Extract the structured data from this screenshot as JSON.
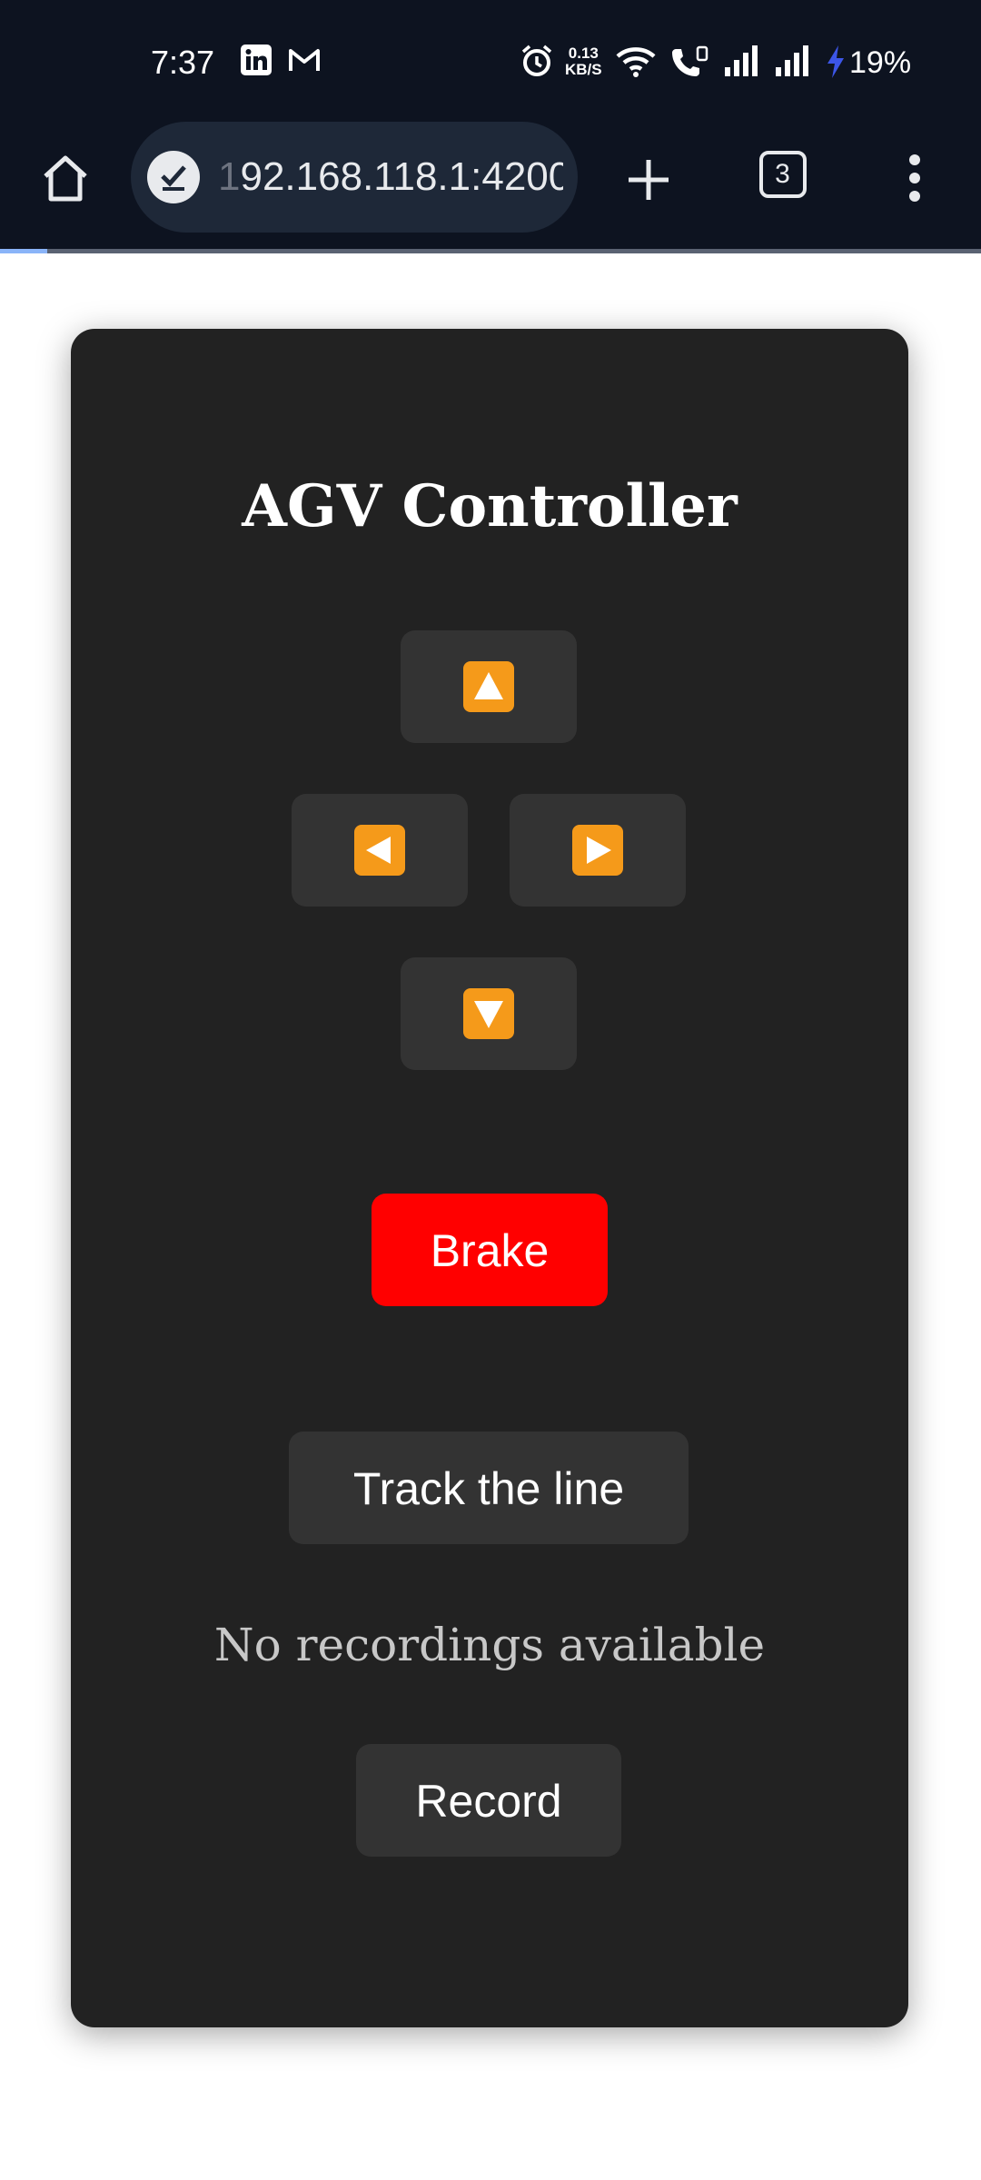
{
  "status_bar": {
    "time": "7:37",
    "network_speed_value": "0.13",
    "network_speed_unit": "KB/S",
    "battery": "19%",
    "icons": [
      "linkedin-icon",
      "gmail-icon",
      "alarm-icon",
      "wifi-icon",
      "wifi-calling-icon",
      "signal-icon",
      "signal-icon",
      "charging-icon"
    ]
  },
  "browser": {
    "url_faded": "1",
    "url": "92.168.118.1:4200",
    "tab_count": "3",
    "icons": [
      "home-icon",
      "site-info-icon",
      "plus-icon",
      "tabs-icon",
      "more-icon"
    ]
  },
  "app": {
    "title": "AGV Controller",
    "controls": {
      "up_icon": "up-arrow-icon",
      "left_icon": "left-arrow-icon",
      "right_icon": "right-arrow-icon",
      "down_icon": "down-arrow-icon"
    },
    "brake_label": "Brake",
    "track_label": "Track the line",
    "no_recordings_text": "No recordings available",
    "record_label": "Record",
    "colors": {
      "brake": "#ff0000",
      "arrow": "#f59a1a",
      "card": "#222222",
      "button": "#333333"
    }
  }
}
